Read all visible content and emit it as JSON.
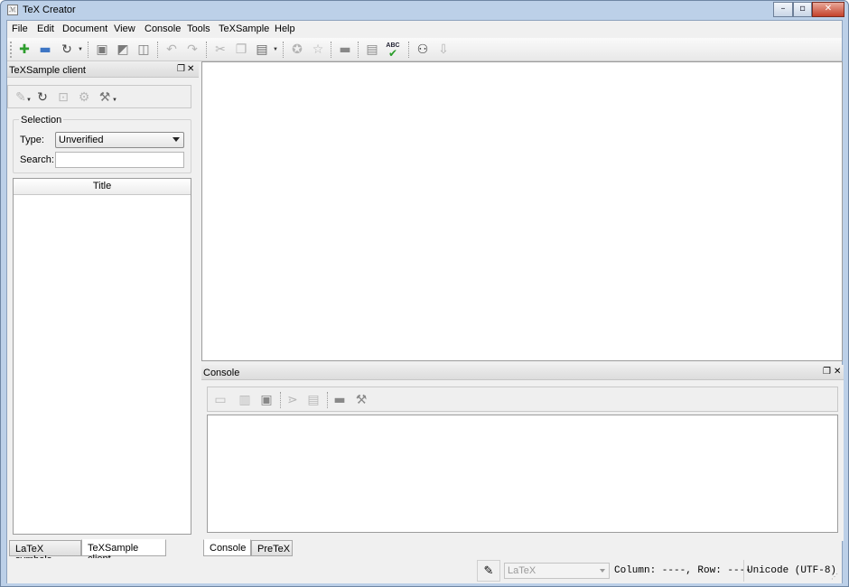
{
  "window": {
    "title": "TeX Creator"
  },
  "menubar": {
    "items": [
      "File",
      "Edit",
      "Document",
      "View",
      "Console",
      "Tools",
      "TeXSample",
      "Help"
    ]
  },
  "toolbar": {
    "icons": [
      "new-document",
      "print",
      "reload",
      "save",
      "save-as",
      "save-all",
      "undo",
      "redo",
      "cut",
      "copy",
      "paste",
      "insert-template",
      "bookmark",
      "horizontal-rule",
      "document-info",
      "spellcheck",
      "find",
      "go-down"
    ],
    "spellcheck_glyph": "ABC"
  },
  "left_dock": {
    "title": "TeXSample client",
    "selection": {
      "title": "Selection",
      "type_label": "Type:",
      "type_value": "Unverified",
      "search_label": "Search:",
      "search_value": ""
    },
    "list_header": "Title"
  },
  "console_dock": {
    "title": "Console"
  },
  "left_tabs": [
    "LaTeX symbols",
    "TeXSample client"
  ],
  "bottom_tabs": [
    "Console",
    "PreTeX"
  ],
  "statusbar": {
    "language": "LaTeX",
    "cursor": "Column: ----, Row: ----",
    "encoding": "Unicode (UTF-8)"
  },
  "colors": {
    "frame": "#bcd0e8",
    "close_button": "#c4412a",
    "spellcheck_green": "#2a9d2a"
  }
}
